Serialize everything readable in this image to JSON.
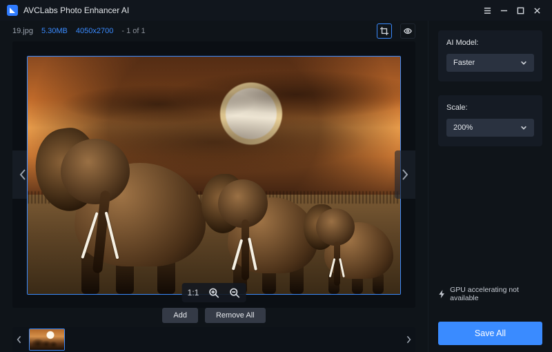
{
  "app": {
    "title": "AVCLabs Photo Enhancer AI"
  },
  "file": {
    "name": "19.jpg",
    "size": "5.30MB",
    "dimensions": "4050x2700",
    "index_label": "- 1 of 1"
  },
  "zoom": {
    "ratio_label": "1:1"
  },
  "actions": {
    "add": "Add",
    "remove_all": "Remove All"
  },
  "sidebar": {
    "model": {
      "label": "AI Model:",
      "value": "Faster"
    },
    "scale": {
      "label": "Scale:",
      "value": "200%"
    },
    "gpu_status": "GPU accelerating not available",
    "save_all": "Save All"
  }
}
